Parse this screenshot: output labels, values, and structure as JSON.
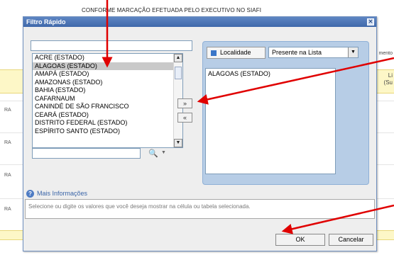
{
  "background": {
    "header": "CONFORME MARCAÇÃO EFETUADA PELO EXECUTIVO NO SIAFI",
    "right_top": "mento",
    "right_col1": "Li",
    "right_col2": "(Su",
    "left_labels": [
      "RA",
      "RA",
      "RA",
      "RA"
    ]
  },
  "dialog": {
    "title": "Filtro Rápido",
    "close_glyph": "✕",
    "list_items": [
      "ACRE (ESTADO)",
      "ALAGOAS (ESTADO)",
      "AMAPÁ (ESTADO)",
      "AMAZONAS (ESTADO)",
      "BAHIA (ESTADO)",
      "CAFARNAUM",
      "CANINDÉ DE SÃO FRANCISCO",
      "CEARÁ (ESTADO)",
      "DISTRITO FEDERAL (ESTADO)",
      "ESPÍRITO SANTO (ESTADO)"
    ],
    "selected_index": 1,
    "move_right_label": "»",
    "move_left_label": "«",
    "localidade_label": "Localidade",
    "presence_select_value": "Presente na Lista",
    "selected_values": [
      "ALAGOAS (ESTADO)"
    ],
    "info_label": "Mais Informações",
    "info_text": "Selecione ou digite os valores que você deseja mostrar na célula ou tabela selecionada.",
    "ok_label": "OK",
    "cancel_label": "Cancelar"
  },
  "icons": {
    "close": "close-icon",
    "binoculars": "binoculars-icon",
    "info": "info-icon",
    "dropdown": "chevron-down-icon",
    "localidade": "dimension-icon"
  },
  "colors": {
    "titlebar": "#4a73b5",
    "panel": "#b7cde6",
    "annotation_arrow": "#e00000",
    "band": "#fdf7c7"
  }
}
